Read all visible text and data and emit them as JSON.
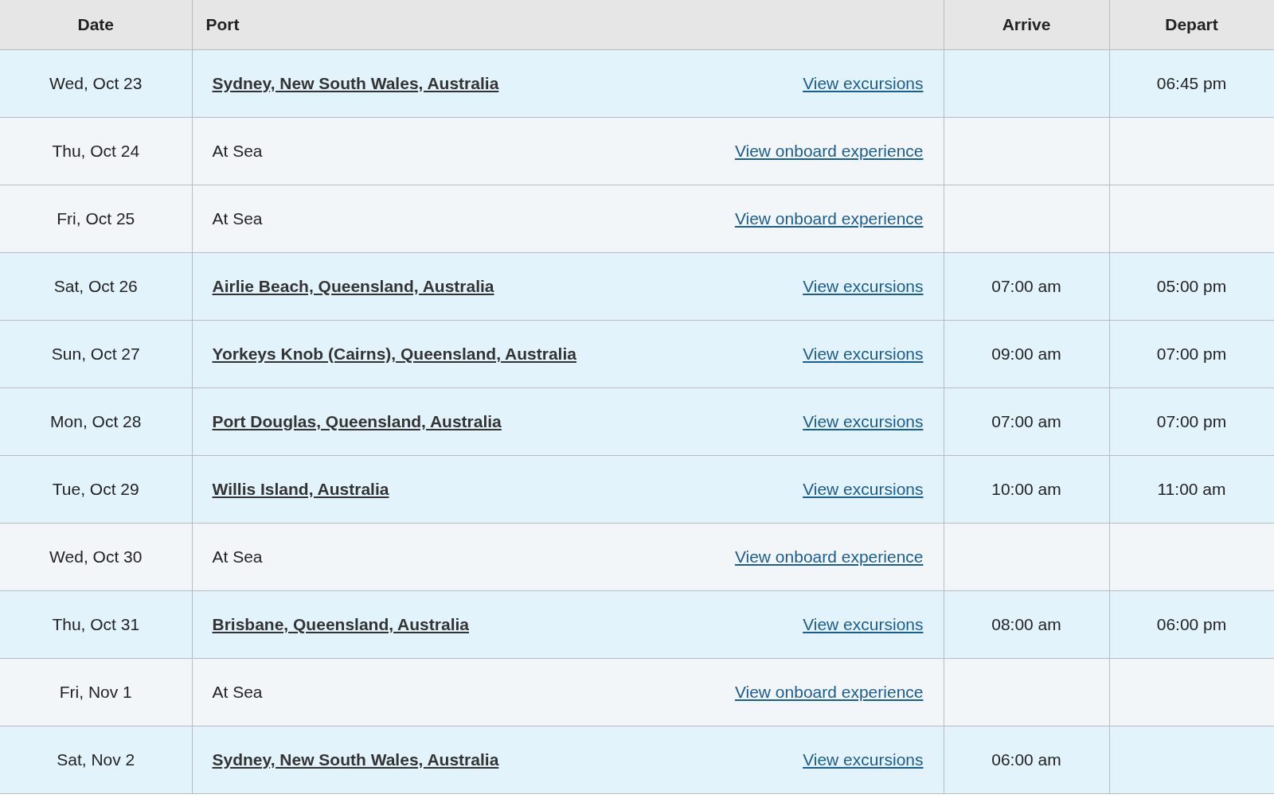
{
  "table": {
    "columns": [
      "Date",
      "Port",
      "Arrive",
      "Depart"
    ],
    "rows": [
      {
        "kind": "port",
        "date": "Wed, Oct 23",
        "port": "Sydney, New South Wales, Australia",
        "link": "View excursions",
        "depart": "06:45 pm"
      },
      {
        "kind": "sea",
        "date": "Thu, Oct 24",
        "port": "At Sea",
        "link": "View onboard experience"
      },
      {
        "kind": "sea",
        "date": "Fri, Oct 25",
        "port": "At Sea",
        "link": "View onboard experience"
      },
      {
        "kind": "port",
        "date": "Sat, Oct 26",
        "port": "Airlie Beach, Queensland, Australia",
        "link": "View excursions",
        "arrive": "07:00 am",
        "depart": "05:00 pm"
      },
      {
        "kind": "port",
        "date": "Sun, Oct 27",
        "port": "Yorkeys Knob (Cairns), Queensland, Australia",
        "link": "View excursions",
        "arrive": "09:00 am",
        "depart": "07:00 pm"
      },
      {
        "kind": "port",
        "date": "Mon, Oct 28",
        "port": "Port Douglas, Queensland, Australia",
        "link": "View excursions",
        "arrive": "07:00 am",
        "depart": "07:00 pm"
      },
      {
        "kind": "port",
        "date": "Tue, Oct 29",
        "port": "Willis Island, Australia",
        "link": "View excursions",
        "arrive": "10:00 am",
        "depart": "11:00 am"
      },
      {
        "kind": "sea",
        "date": "Wed, Oct 30",
        "port": "At Sea",
        "link": "View onboard experience"
      },
      {
        "kind": "port",
        "date": "Thu, Oct 31",
        "port": "Brisbane, Queensland, Australia",
        "link": "View excursions",
        "arrive": "08:00 am",
        "depart": "06:00 pm"
      },
      {
        "kind": "sea",
        "date": "Fri, Nov 1",
        "port": "At Sea",
        "link": "View onboard experience"
      },
      {
        "kind": "port",
        "date": "Sat, Nov 2",
        "port": "Sydney, New South Wales, Australia",
        "link": "View excursions",
        "arrive": "06:00 am"
      }
    ]
  }
}
